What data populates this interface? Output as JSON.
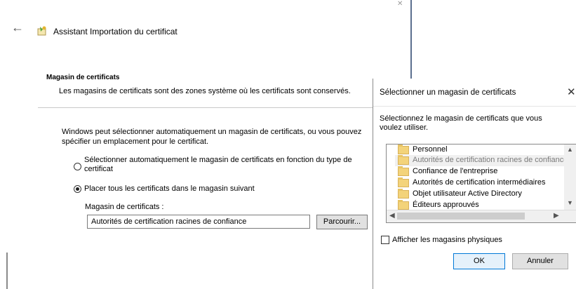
{
  "wizard": {
    "title": "Assistant Importation du certificat",
    "header_title": "Magasin de certificats",
    "header_desc": "Les magasins de certificats sont des zones système où les certificats sont conservés.",
    "intro": "Windows peut sélectionner automatiquement un magasin de certificats, ou vous pouvez spécifier un emplacement pour le certificat.",
    "option_auto": "Sélectionner automatiquement le magasin de certificats en fonction du type de certificat",
    "option_manual": "Placer tous les certificats dans le magasin suivant",
    "selected_option": "manual",
    "store_label": "Magasin de certificats :",
    "store_value": "Autorités de certification racines de confiance",
    "browse_label": "Parcourir..."
  },
  "dialog": {
    "title": "Sélectionner un magasin de certificats",
    "prompt": "Sélectionnez le magasin de certificats que vous voulez utiliser.",
    "stores": [
      "Personnel",
      "Autorités de certification racines de confiance",
      "Confiance de l'entreprise",
      "Autorités de certification intermédiaires",
      "Objet utilisateur Active Directory",
      "Éditeurs approuvés"
    ],
    "selected_index": 1,
    "show_physical_label": "Afficher les magasins physiques",
    "show_physical_checked": false,
    "ok_label": "OK",
    "cancel_label": "Annuler"
  },
  "icons": {
    "back": "back-arrow-icon",
    "wizard": "certificate-icon",
    "folder": "folder-icon",
    "close": "close-icon"
  },
  "colors": {
    "accent": "#0078d7",
    "folder": "#f3d37a"
  }
}
